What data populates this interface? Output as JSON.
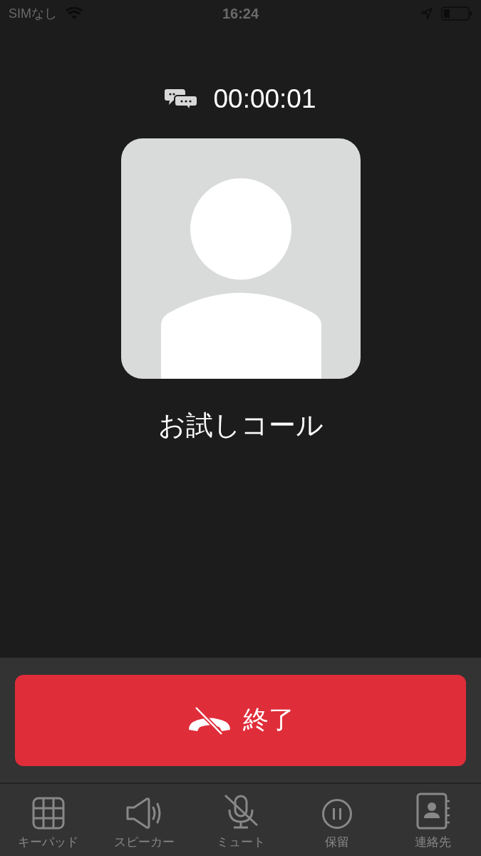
{
  "status_bar": {
    "carrier": "SIMなし",
    "time": "16:24"
  },
  "call": {
    "duration": "00:00:01",
    "name": "お試しコール"
  },
  "end_button": {
    "label": "終了"
  },
  "toolbar": [
    {
      "kind": "keypad",
      "label": "キーパッド"
    },
    {
      "kind": "speaker",
      "label": "スピーカー"
    },
    {
      "kind": "mute",
      "label": "ミュート"
    },
    {
      "kind": "hold",
      "label": "保留"
    },
    {
      "kind": "contacts",
      "label": "連絡先"
    }
  ]
}
